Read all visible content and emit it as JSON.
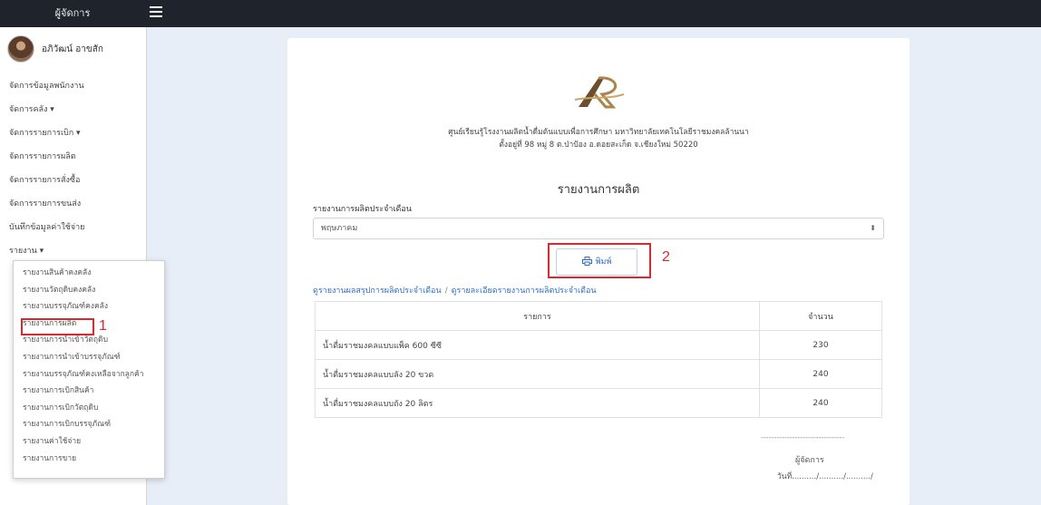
{
  "topbar": {
    "brand": "ผู้จัดการ",
    "menu_icon": "hamburger-icon"
  },
  "profile": {
    "name": "อภิวัฒน์ อาขสัก"
  },
  "sidebar": {
    "items": [
      {
        "label": "จัดการข้อมูลพนักงาน"
      },
      {
        "label": "จัดการคลัง ▾"
      },
      {
        "label": "จัดการรายการเบิก ▾"
      },
      {
        "label": "จัดการรายการผลิต"
      },
      {
        "label": "จัดการรายการสั่งซื้อ"
      },
      {
        "label": "จัดการรายการขนส่ง"
      },
      {
        "label": "บันทึกข้อมูลค่าใช้จ่าย"
      },
      {
        "label": "รายงาน ▾"
      }
    ]
  },
  "dropdown": {
    "items": [
      {
        "label": "รายงานสินค้าคงคลัง"
      },
      {
        "label": "รายงานวัตถุดิบคงคลัง"
      },
      {
        "label": "รายงานบรรจุภัณฑ์คงคลัง"
      },
      {
        "label": "รายงานการผลิต"
      },
      {
        "label": "รายงานการนำเข้าวัตถุดิบ"
      },
      {
        "label": "รายงานการนำเข้าบรรจุภัณฑ์"
      },
      {
        "label": "รายงานบรรจุภัณฑ์คงเหลือจากลูกค้า"
      },
      {
        "label": "รายงานการเบิกสินค้า"
      },
      {
        "label": "รายงานการเบิกวัตถุดิบ"
      },
      {
        "label": "รายงานการเบิกบรรจุภัณฑ์"
      },
      {
        "label": "รายงานค่าใช้จ่าย"
      },
      {
        "label": "รายงานการขาย"
      }
    ]
  },
  "annotations": {
    "one": "1",
    "two": "2",
    "accent": "#d9282f"
  },
  "report": {
    "org_line1": "ศูนย์เรียนรู้โรงงานผลิตน้ำดื่มต้นแบบเพื่อการศึกษา มหาวิทยาลัยเทคโนโลยีราชมงคลล้านนา",
    "org_line2": "ตั้งอยู่ที่ 98 หมู่ 8 ต.ป่าป้อง อ.ดอยสะเก็ด จ.เชียงใหม่ 50220",
    "title": "รายงานการผลิต",
    "select_label": "รายงานการผลิตประจำเดือน",
    "select_value": "พฤษภาคม",
    "print_label": "พิมพ์",
    "link_summary": "ดูรายงานผลสรุปการผลิตประจำเดือน",
    "link_sep": "/",
    "link_detail": "ดูรายละเอียดรายงานการผลิตประจำเดือน",
    "table": {
      "headers": [
        "รายการ",
        "จำนวน"
      ],
      "rows": [
        {
          "name": "น้ำดื่มราชมงคลแบบแพ็ค 600 ซีซี",
          "qty": "230"
        },
        {
          "name": "น้ำดื่มราชมงคลแบบลัง 20 ขวด",
          "qty": "240"
        },
        {
          "name": "น้ำดื่มราชมงคลแบบถัง 20 ลิตร",
          "qty": "240"
        }
      ]
    },
    "sign_line": "--------------------------------",
    "sign_role": "ผู้จัดการ",
    "sign_date": "วันที่........../........../........../"
  }
}
